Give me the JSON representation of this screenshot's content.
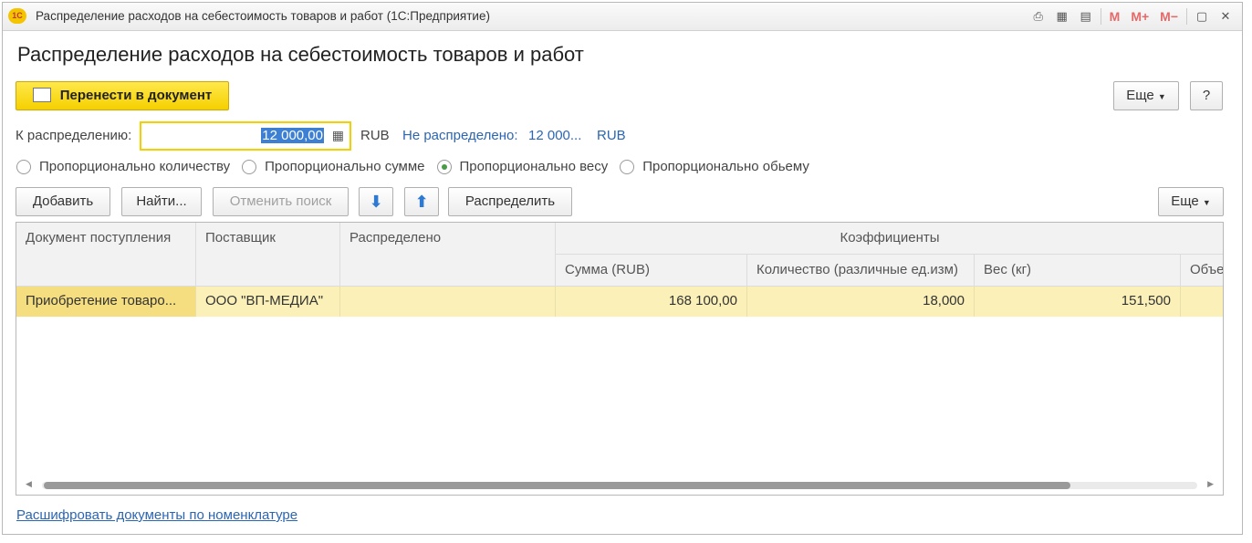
{
  "window": {
    "title": "Распределение расходов на себестоимость товаров и работ  (1С:Предприятие)",
    "app_icon_text": "1С",
    "toolbar_m_labels": [
      "M",
      "M+",
      "M−"
    ]
  },
  "form": {
    "title": "Распределение расходов на себестоимость товаров и работ",
    "transfer_button": "Перенести в документ",
    "more_button": "Еще",
    "help_button": "?"
  },
  "distribution": {
    "label": "К распределению:",
    "amount": "12 000,00",
    "currency": "RUB",
    "undistributed_label": "Не распределено:",
    "undistributed_value": "12 000...",
    "undistributed_currency": "RUB"
  },
  "methods": [
    {
      "label": "Пропорционально количеству",
      "selected": false
    },
    {
      "label": "Пропорционально сумме",
      "selected": false
    },
    {
      "label": "Пропорционально весу",
      "selected": true
    },
    {
      "label": "Пропорционально обьему",
      "selected": false
    }
  ],
  "table_toolbar": {
    "add": "Добавить",
    "find": "Найти...",
    "cancel_search": "Отменить поиск",
    "distribute": "Распределить",
    "more": "Еще"
  },
  "table": {
    "headers": {
      "document": "Документ поступления",
      "supplier": "Поставщик",
      "distributed": "Распределено",
      "coefficients": "Коэффициенты",
      "sum": "Сумма (RUB)",
      "quantity": "Количество (различные ед.изм)",
      "weight": "Вес (кг)",
      "volume": "Объе"
    },
    "rows": [
      {
        "document": "Приобретение товаро...",
        "supplier": "ООО \"ВП-МЕДИА\"",
        "distributed": "",
        "sum": "168 100,00",
        "quantity": "18,000",
        "weight": "151,500",
        "volume": ""
      }
    ]
  },
  "footer": {
    "link": "Расшифровать документы по номенклатуре"
  }
}
